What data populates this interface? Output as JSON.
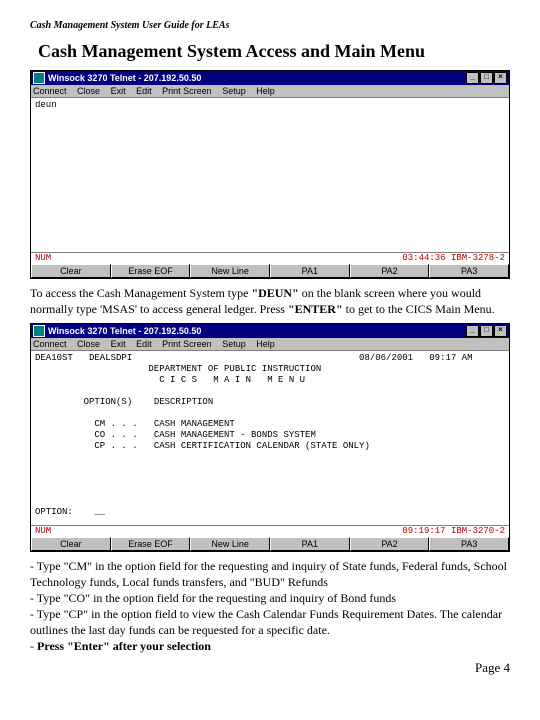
{
  "running_header": "Cash Management System User Guide for LEAs",
  "section_heading": "Cash Management System Access and Main Menu",
  "win1": {
    "title": "Winsock 3270 Telnet - 207.192.50.50",
    "menu": [
      "Connect",
      "Close",
      "Exit",
      "Edit",
      "Print Screen",
      "Setup",
      "Help"
    ],
    "body": "deun",
    "status_left": "NUM",
    "status_right": "03:44:36 IBM-3278-2",
    "fn": [
      "Clear",
      "Erase EOF",
      "New Line",
      "PA1",
      "PA2",
      "PA3"
    ]
  },
  "para1_pre": "To access the Cash Management System type ",
  "para1_b1": "\"DEUN\"",
  "para1_mid": " on the blank screen where you would normally type 'MSAS' to access general ledger.  Press ",
  "para1_b2": "\"ENTER\"",
  "para1_post": " to get to the CICS Main Menu.",
  "win2": {
    "title": "Winsock 3270 Telnet - 207.192.50.50",
    "menu": [
      "Connect",
      "Close",
      "Exit",
      "Edit",
      "Print Screen",
      "Setup",
      "Help"
    ],
    "body_lines": [
      "DEA10ST   DEALSDPI                                          08/06/2001   09:17 AM",
      "                     DEPARTMENT OF PUBLIC INSTRUCTION",
      "                       C I C S   M A I N   M E N U",
      "",
      "         OPTION(S)    DESCRIPTION",
      "",
      "           CM . . .   CASH MANAGEMENT",
      "           CO . . .   CASH MANAGEMENT - BONDS SYSTEM",
      "           CP . . .   CASH CERTIFICATION CALENDAR (STATE ONLY)",
      "",
      "",
      "",
      "",
      "",
      "OPTION:    __"
    ],
    "status_left": "NUM",
    "status_right": "09:19:17 IBM-3270-2",
    "fn": [
      "Clear",
      "Erase EOF",
      "New Line",
      "PA1",
      "PA2",
      "PA3"
    ]
  },
  "bullets": {
    "l1": "- Type \"CM\" in the option field for the requesting and inquiry of  State funds, Federal funds, School Technology funds, Local funds transfers, and \"BUD\" Refunds",
    "l2": "- Type \"CO\" in the option field for the requesting and inquiry of  Bond funds",
    "l3": "- Type \"CP\" in the option field to view the Cash Calendar Funds Requirement Dates. The calendar outlines the last day funds can be requested for a specific date.",
    "l4a": "- ",
    "l4b": "Press \"Enter\" after your selection"
  },
  "page_label": "Page",
  "page_num": "4"
}
